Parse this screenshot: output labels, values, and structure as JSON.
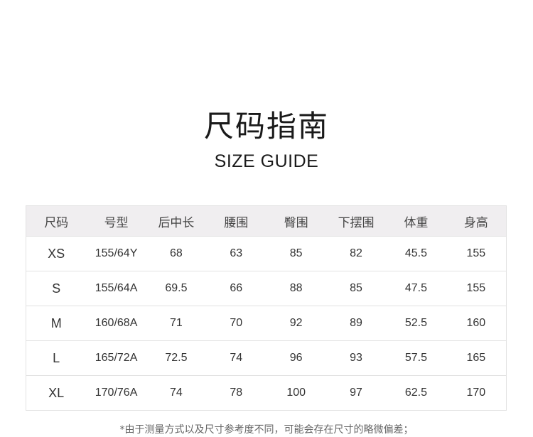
{
  "title": {
    "cn": "尺码指南",
    "en": "SIZE GUIDE"
  },
  "table": {
    "headers": [
      "尺码",
      "号型",
      "后中长",
      "腰围",
      "臀围",
      "下摆围",
      "体重",
      "身高"
    ],
    "rows": [
      [
        "XS",
        "155/64Y",
        "68",
        "63",
        "85",
        "82",
        "45.5",
        "155"
      ],
      [
        "S",
        "155/64A",
        "69.5",
        "66",
        "88",
        "85",
        "47.5",
        "155"
      ],
      [
        "M",
        "160/68A",
        "71",
        "70",
        "92",
        "89",
        "52.5",
        "160"
      ],
      [
        "L",
        "165/72A",
        "72.5",
        "74",
        "96",
        "93",
        "57.5",
        "165"
      ],
      [
        "XL",
        "170/76A",
        "74",
        "78",
        "100",
        "97",
        "62.5",
        "170"
      ]
    ]
  },
  "footnote": "*由于测量方式以及尺寸参考度不同，可能会存在尺寸的略微偏差；"
}
